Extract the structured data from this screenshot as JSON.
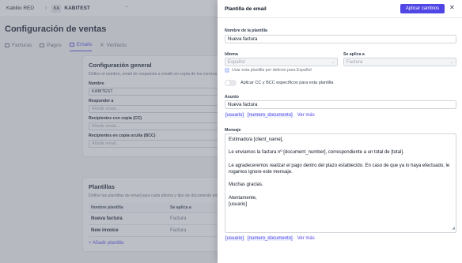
{
  "topbar": {
    "company": "Kabilio RED",
    "workspace_badge": "KA",
    "workspace": "KABITEST"
  },
  "page": {
    "title": "Configuración de ventas",
    "tabs": [
      {
        "label": "Facturas"
      },
      {
        "label": "Pagos"
      },
      {
        "label": "Emails"
      },
      {
        "label": "Verifactu"
      }
    ]
  },
  "general": {
    "title": "Configuración general",
    "desc": "Define el nombre, email de respuesta a emails en copia de los correos e",
    "name_label": "Nombre",
    "name_value": "KABITEST",
    "reply_label": "Responder a",
    "reply_placeholder": "Añadir email...",
    "cc_label": "Recipientes con copia (CC)",
    "cc_placeholder": "Añadir email...",
    "bcc_label": "Recipientes en copia oculta (BCC)",
    "bcc_placeholder": "Añadir email..."
  },
  "templates": {
    "title": "Plantillas",
    "desc": "Define las plantillas de email para cada idioma y tipo de documento env",
    "col_name": "Nombre plantilla",
    "col_applies": "Se aplica a",
    "rows": [
      {
        "name": "Nueva factura",
        "applies": "Factura"
      },
      {
        "name": "New invoice",
        "applies": "Factura"
      }
    ],
    "add_label": "+ Añadir plantilla"
  },
  "drawer": {
    "title": "Plantilla de email",
    "apply_label": "Aplicar cambios",
    "close_icon": "close-icon",
    "name_label": "Nombre de la plantilla",
    "name_value": "Nueva factura",
    "language_label": "Idioma",
    "language_value": "Español",
    "applies_label": "Se aplica a",
    "applies_value": "Factura",
    "default_checkbox_label": "Usar esta plantilla por defecto para Español",
    "cc_toggle_label": "Aplicar CC y BCC específicos para esta plantilla",
    "subject_label": "Asunto",
    "subject_value": "Nueva factura",
    "subject_vars": [
      "[usuario]",
      "[numero_documento]"
    ],
    "subject_more": "Ver más",
    "message_label": "Mensaje",
    "message_lines": {
      "greeting": "Estimado/a [client_name],",
      "body1": "Le enviamos la factura nº [document_number], correspondiente a un total de [total].",
      "body2a": "Le agradeceremos realizar el pago dentro del plazo establecido. En caso de que ya lo haya efectuado, le",
      "body2b": "rogamos ignore este mensaje.",
      "thanks": "Muchas gracias.",
      "closing": "Atentamente,",
      "signature": "[usuario]"
    },
    "message_vars": [
      "[usuario]",
      "[numero_documento]"
    ],
    "message_more": "Ver más"
  },
  "colors": {
    "accent": "#4f46e5",
    "overlay": "rgba(107,114,128,0.45)"
  }
}
